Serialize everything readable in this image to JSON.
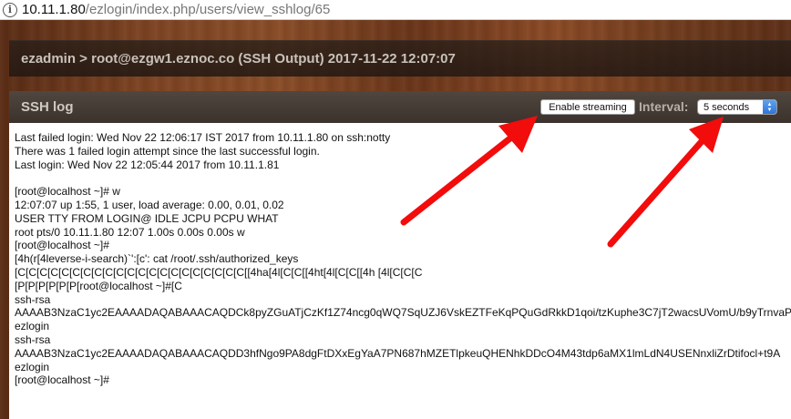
{
  "browser": {
    "url_host": "10.11.1.80",
    "url_path": "/ezlogin/index.php/users/view_sshlog/65"
  },
  "header": {
    "title": "ezadmin > root@ezgw1.eznoc.co (SSH Output) 2017-11-22 12:07:07"
  },
  "panel": {
    "title": "SSH log",
    "stream_button_label": "Enable streaming",
    "interval_label": "Interval:",
    "interval_value": "5 seconds"
  },
  "log_lines": [
    "Last failed login: Wed Nov 22 12:06:17 IST 2017 from 10.11.1.80 on ssh:notty",
    "There was 1 failed login attempt since the last successful login.",
    "Last login: Wed Nov 22 12:05:44 2017 from 10.11.1.81",
    "",
    "[root@localhost ~]# w",
    "12:07:07 up 1:55, 1 user, load average: 0.00, 0.01, 0.02",
    "USER TTY FROM LOGIN@ IDLE JCPU PCPU WHAT",
    "root pts/0 10.11.1.80 12:07 1.00s 0.00s 0.00s w",
    "[root@localhost ~]#",
    "[4h(r[4leverse-i-search)`':[c': cat /root/.ssh/authorized_keys",
    "[C[C[C[C[C[C[C[C[C[C[C[C[C[C[C[C[C[C[C[C[C[[4ha[4l[C[C[[4ht[4l[C[C[[4h [4l[C[C[C",
    "[P[P[P[P[P[P[root@localhost ~]#[C",
    "ssh-rsa",
    "AAAAB3NzaC1yc2EAAAADAQABAAACAQDCk8pyZGuATjCzKf1Z74ncg0qWQ7SqUZJ6VskEZTFeKqPQuGdRkkD1qoi/tzKuphe3C7jT2wacsUVomU/b9yTrnvaP",
    "ezlogin",
    "ssh-rsa",
    "AAAAB3NzaC1yc2EAAAADAQABAAACAQDD3hfNgo9PA8dgFtDXxEgYaA7PN687hMZETlpkeuQHENhkDDcO4M43tdp6aMX1lmLdN4USENnxliZrDtifocl+t9A",
    "ezlogin",
    "[root@localhost ~]#"
  ],
  "colors": {
    "arrow": "#f20c0c",
    "header_text": "#c8c2bb",
    "interval_chevron": "#2f74d9"
  }
}
